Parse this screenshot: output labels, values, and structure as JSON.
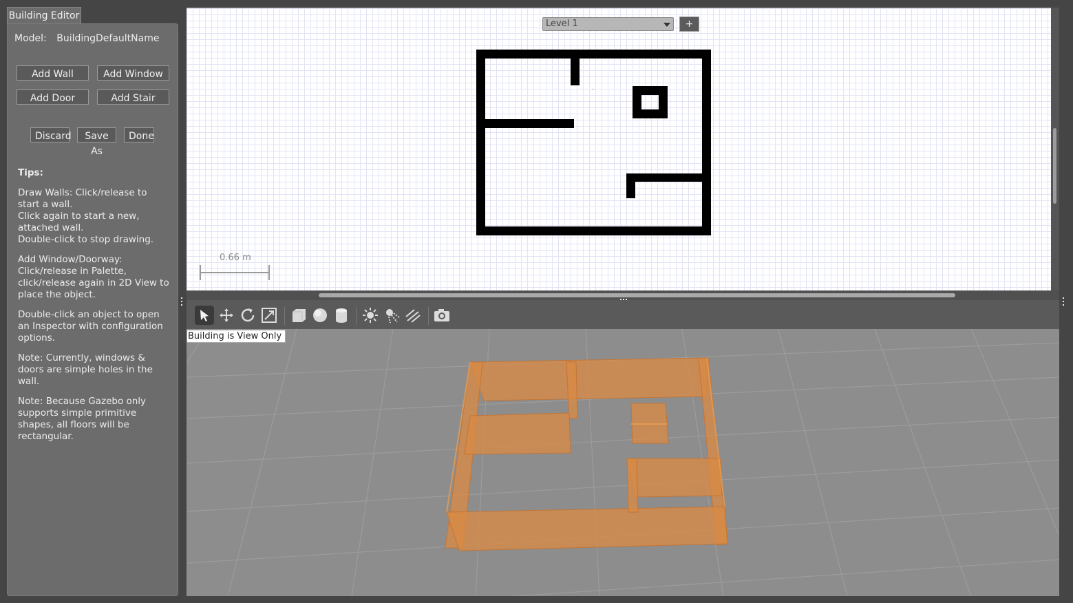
{
  "palette": {
    "tab_label": "Building Editor",
    "model_label": "Model:",
    "model_name": "BuildingDefaultName",
    "add_wall": "Add Wall",
    "add_window": "Add Window",
    "add_door": "Add Door",
    "add_stair": "Add Stair",
    "discard": "Discard",
    "save_as": "Save As",
    "done": "Done",
    "tips_title": "Tips:",
    "tips": [
      "Draw Walls: Click/release to start a wall.\nClick again to start a new, attached wall.\nDouble-click to stop drawing.",
      "Add Window/Doorway: Click/release in Palette, click/release again in 2D View to place the object.",
      "Double-click an object to open an Inspector with configuration options.",
      "Note: Currently, windows & doors are simple holes in the wall.",
      "Note: Because Gazebo only supports simple primitive shapes, all floors will be rectangular."
    ]
  },
  "view2d": {
    "level": "Level 1",
    "add_level": "+",
    "scale_label": "0.66 m"
  },
  "toolbar": {
    "tools": [
      "select-arrow-icon",
      "translate-icon",
      "rotate-icon",
      "scale-icon",
      "box-icon",
      "sphere-icon",
      "cylinder-icon",
      "point-light-icon",
      "spot-light-icon",
      "directional-light-icon",
      "screenshot-icon"
    ]
  },
  "view3d": {
    "status": "Building is View Only",
    "wall_color": "#d98a45",
    "ground_color": "#8d8d8d"
  }
}
